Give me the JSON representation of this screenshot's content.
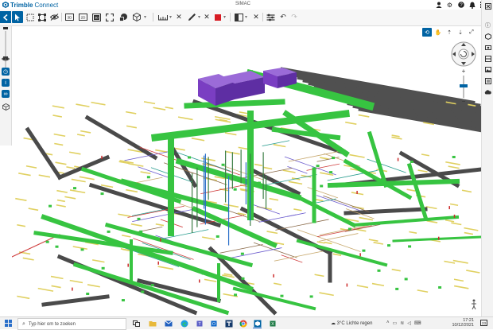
{
  "app": {
    "brand_name": "Trimble",
    "brand_suffix": "Connect",
    "project": "SIMAC",
    "brand_color": "#0063a3"
  },
  "top_icons": [
    "user-icon",
    "gear-icon",
    "help-icon",
    "bell-icon",
    "grid-icon"
  ],
  "toolbar": {
    "tools": [
      "back-icon",
      "select-icon",
      "box-select-icon",
      "polygon-select-icon",
      "hide-icon",
      "view-3d-icon",
      "view-2d-icon",
      "view-top-icon",
      "fit-icon",
      "objects-icon",
      "cube-icon",
      "measure-icon",
      "pen-icon",
      "clear-markup-icon",
      "color-swatch",
      "section-icon",
      "clear-section-icon",
      "settings-icon",
      "undo-icon",
      "redo-icon"
    ],
    "markup_color": "#d71c24"
  },
  "left_panel": {
    "icons": [
      "zoom-slider",
      "eye-icon",
      "timeline-icon",
      "info-icon",
      "link-icon",
      "layers-icon"
    ]
  },
  "right_rail": {
    "icons": [
      "close-panel-icon",
      "properties-icon",
      "models-icon",
      "views-icon",
      "clash-icon",
      "images-icon",
      "attach-icon",
      "cloud-icon"
    ]
  },
  "nav": {
    "tools": [
      "orbit-icon",
      "pan-icon",
      "walk-icon",
      "walk-gravity-icon",
      "fullscreen-icon"
    ]
  },
  "model": {
    "roof_color": "#505050",
    "duct_color": "#37c441",
    "equipment_color": "#7a3ec2",
    "pipe_color": "#c8a96e",
    "gas_color": "#e0d060",
    "red_line_color": "#d04040"
  },
  "taskbar": {
    "search_placeholder": "Typ hier om te zoeken",
    "weather": "3°C  Lichte regen",
    "time": "17:21",
    "date": "10/12/2021",
    "notification_count": "23"
  }
}
